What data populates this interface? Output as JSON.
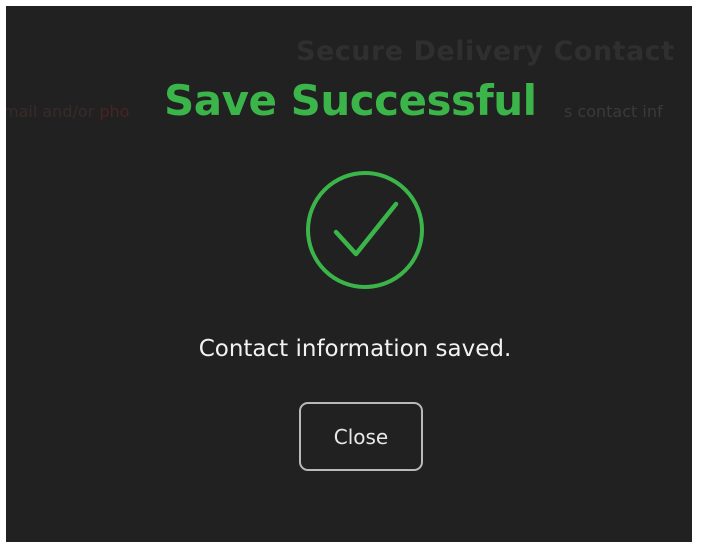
{
  "background_page": {
    "title": "Secure Delivery Contact",
    "subtitle_left_plain": "mail and/or ",
    "subtitle_left_red": "pho",
    "subtitle_right": "s contact inf"
  },
  "modal": {
    "title": "Save Successful",
    "icon": "check-circle-icon",
    "message": "Contact information saved.",
    "close_label": "Close"
  },
  "colors": {
    "success_green": "#3bb54a",
    "overlay_background": "#212121",
    "message_text": "#f2f2f2",
    "button_border": "#b9b9b9"
  }
}
